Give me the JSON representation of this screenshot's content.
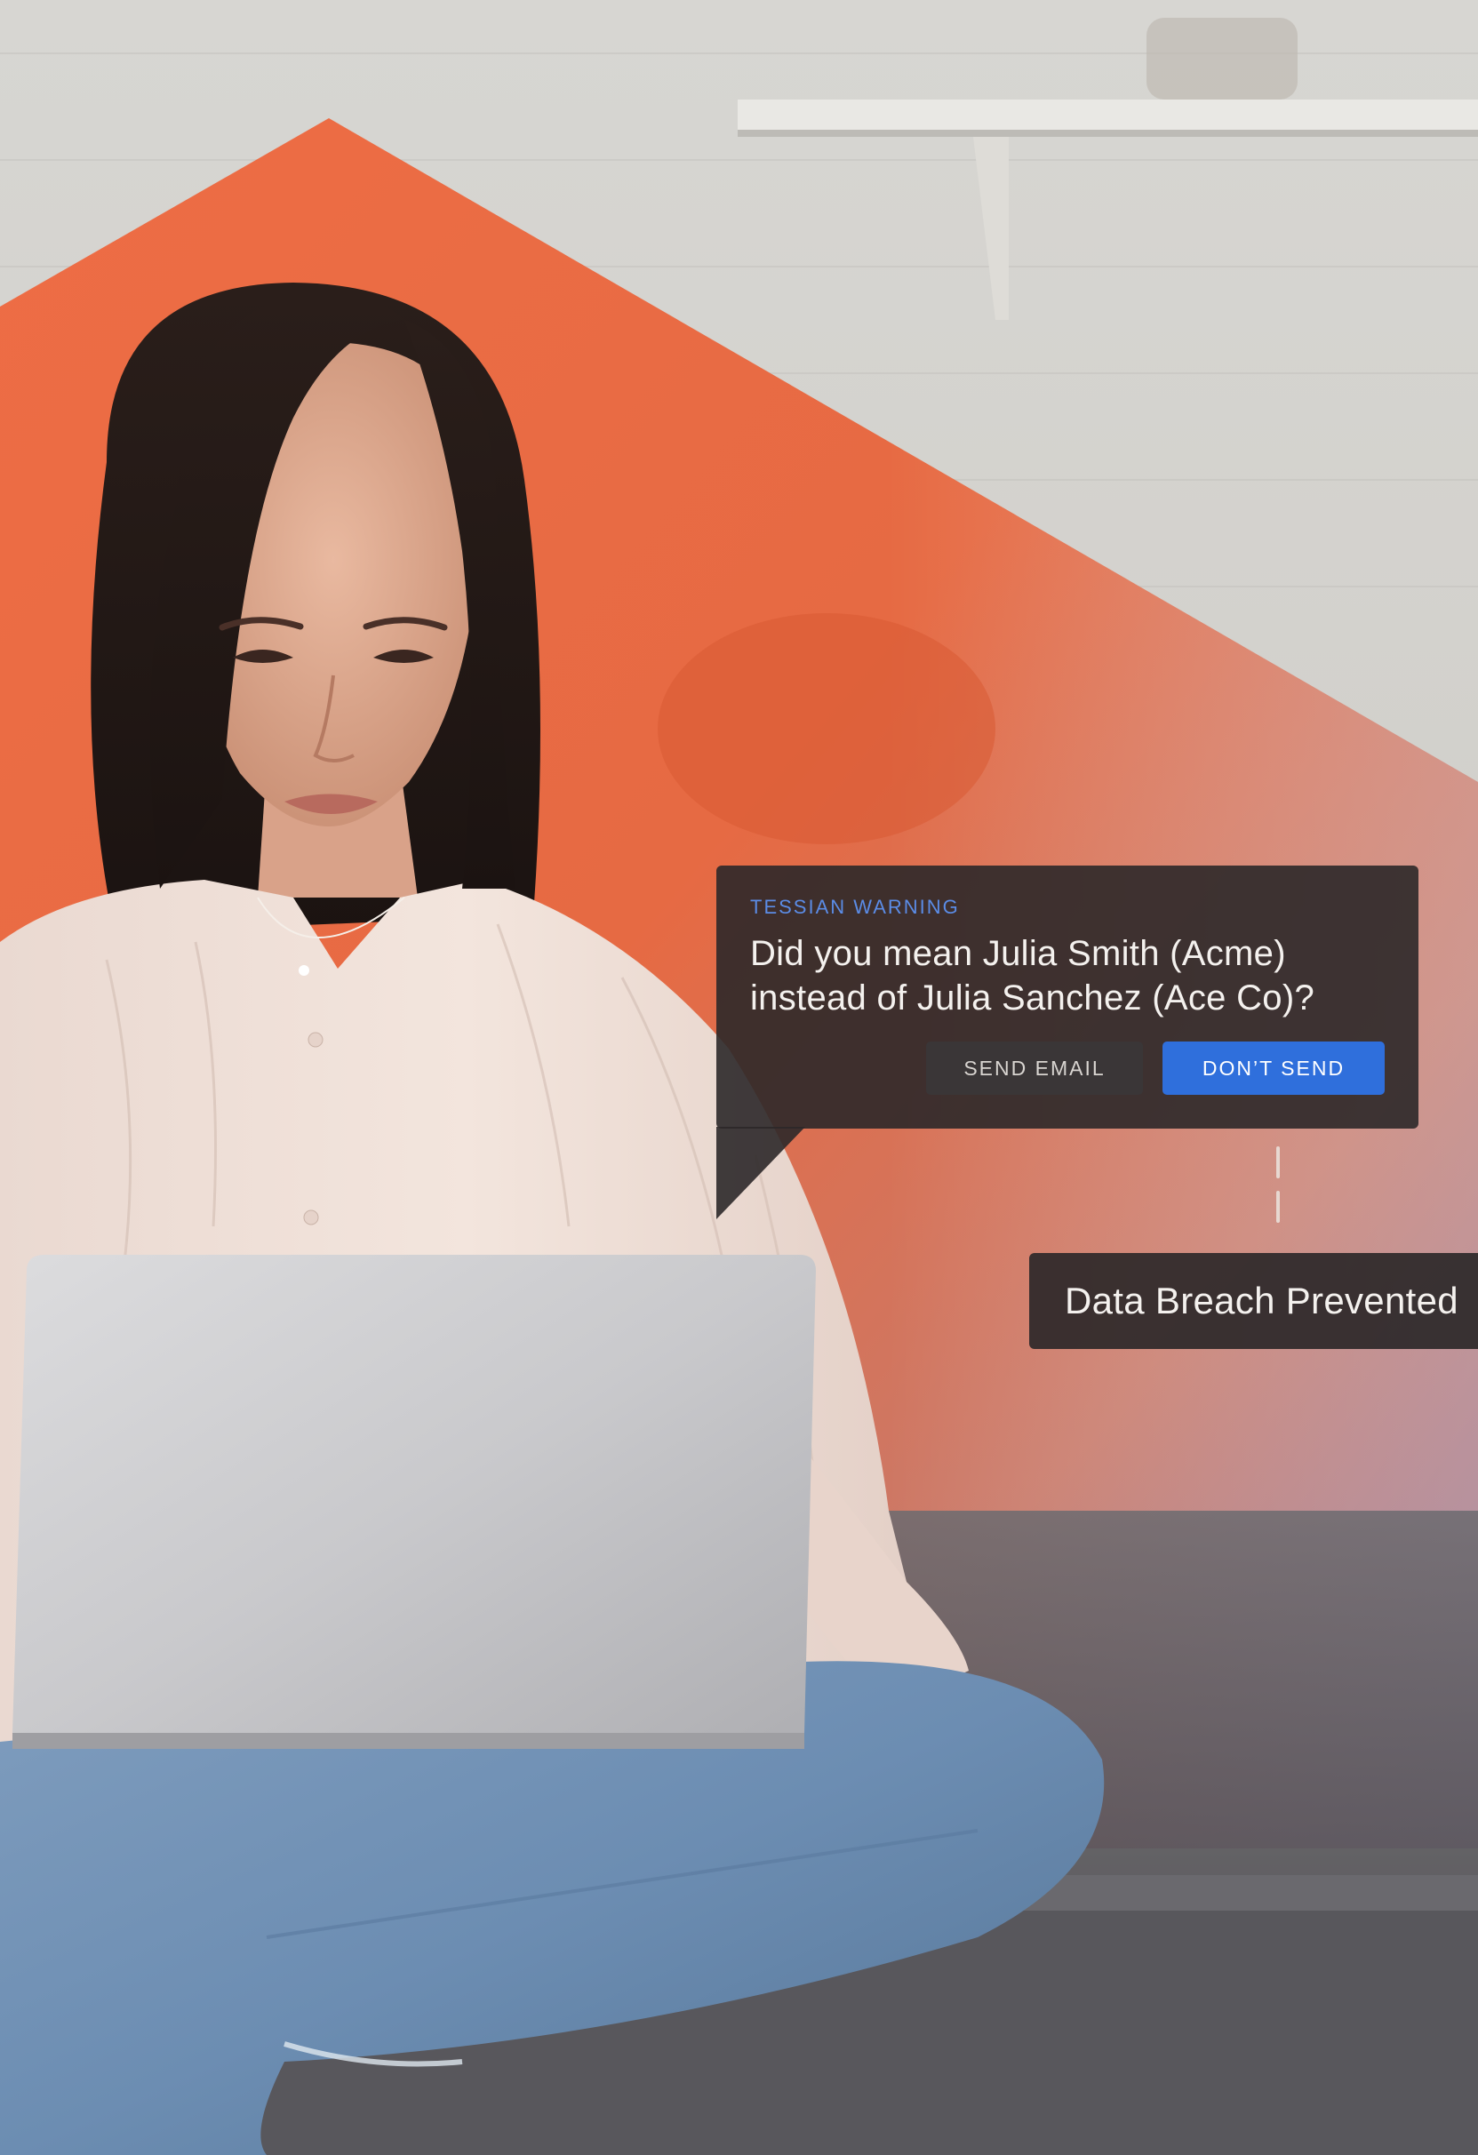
{
  "warning": {
    "label": "TESSIAN WARNING",
    "line1": "Did you mean Julia Smith (Acme)",
    "line2": "instead of Julia Sanchez (Ace Co)?",
    "send_label": "SEND EMAIL",
    "dont_send_label": "DON’T SEND"
  },
  "breach": {
    "label": "Data Breach Prevented"
  },
  "colors": {
    "accent_blue": "#2f6fdc",
    "label_blue": "#5b8ce6",
    "card_dark": "#2c2829",
    "brand_orange": "#e8643a"
  }
}
